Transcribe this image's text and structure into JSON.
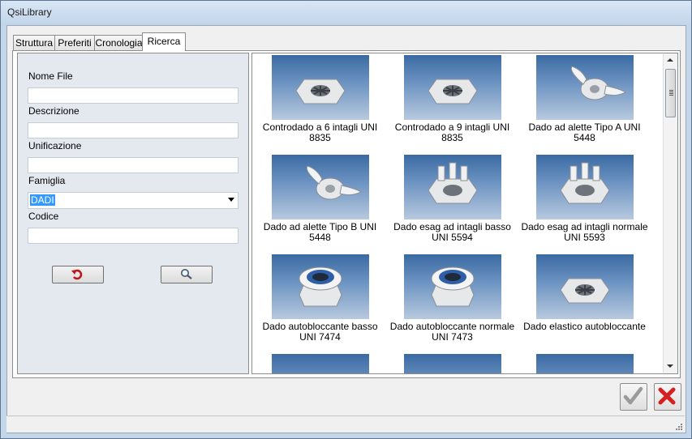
{
  "window": {
    "title": "QsiLibrary"
  },
  "tabs": [
    {
      "label": "Struttura"
    },
    {
      "label": "Preferiti"
    },
    {
      "label": "Cronologia"
    },
    {
      "label": "Ricerca",
      "active": true
    }
  ],
  "search_form": {
    "nome_file": {
      "label": "Nome File",
      "value": ""
    },
    "descrizione": {
      "label": "Descrizione",
      "value": ""
    },
    "unificazione": {
      "label": "Unificazione",
      "value": ""
    },
    "famiglia": {
      "label": "Famiglia",
      "value": "DADI"
    },
    "codice": {
      "label": "Codice",
      "value": ""
    },
    "reset_icon": "undo-arrow-icon",
    "search_icon": "magnifier-icon"
  },
  "results": [
    {
      "caption": "Controdado a 6 intagli UNI 8835",
      "icon": "slotted-locknut-6-icon"
    },
    {
      "caption": "Controdado a 9 intagli UNI 8835",
      "icon": "slotted-locknut-9-icon"
    },
    {
      "caption": "Dado ad alette Tipo A UNI 5448",
      "icon": "wing-nut-a-icon"
    },
    {
      "caption": "Dado ad alette Tipo B UNI 5448",
      "icon": "wing-nut-b-icon"
    },
    {
      "caption": "Dado esag ad intagli basso UNI 5594",
      "icon": "castle-nut-low-icon"
    },
    {
      "caption": "Dado esag ad intagli normale UNI 5593",
      "icon": "castle-nut-normal-icon"
    },
    {
      "caption": "Dado autobloccante basso UNI 7474",
      "icon": "nylon-locknut-low-icon"
    },
    {
      "caption": "Dado autobloccante normale UNI 7473",
      "icon": "nylon-locknut-normal-icon"
    },
    {
      "caption": "Dado elastico autobloccante",
      "icon": "elastic-locknut-icon"
    },
    {
      "caption": "",
      "icon": "nut-thumbnail-icon"
    },
    {
      "caption": "",
      "icon": "nut-thumbnail-icon"
    },
    {
      "caption": "",
      "icon": "nut-thumbnail-icon"
    }
  ],
  "footer": {
    "ok_icon": "checkmark-icon",
    "cancel_icon": "red-x-icon"
  },
  "colors": {
    "title_bg": "#c9dcf0",
    "panel_bg": "#e4e9f0",
    "thumb_top": "#3a6aa3",
    "thumb_bottom": "#b7c9de",
    "cancel_red": "#d42020",
    "ok_gray": "#9a9a9a"
  }
}
